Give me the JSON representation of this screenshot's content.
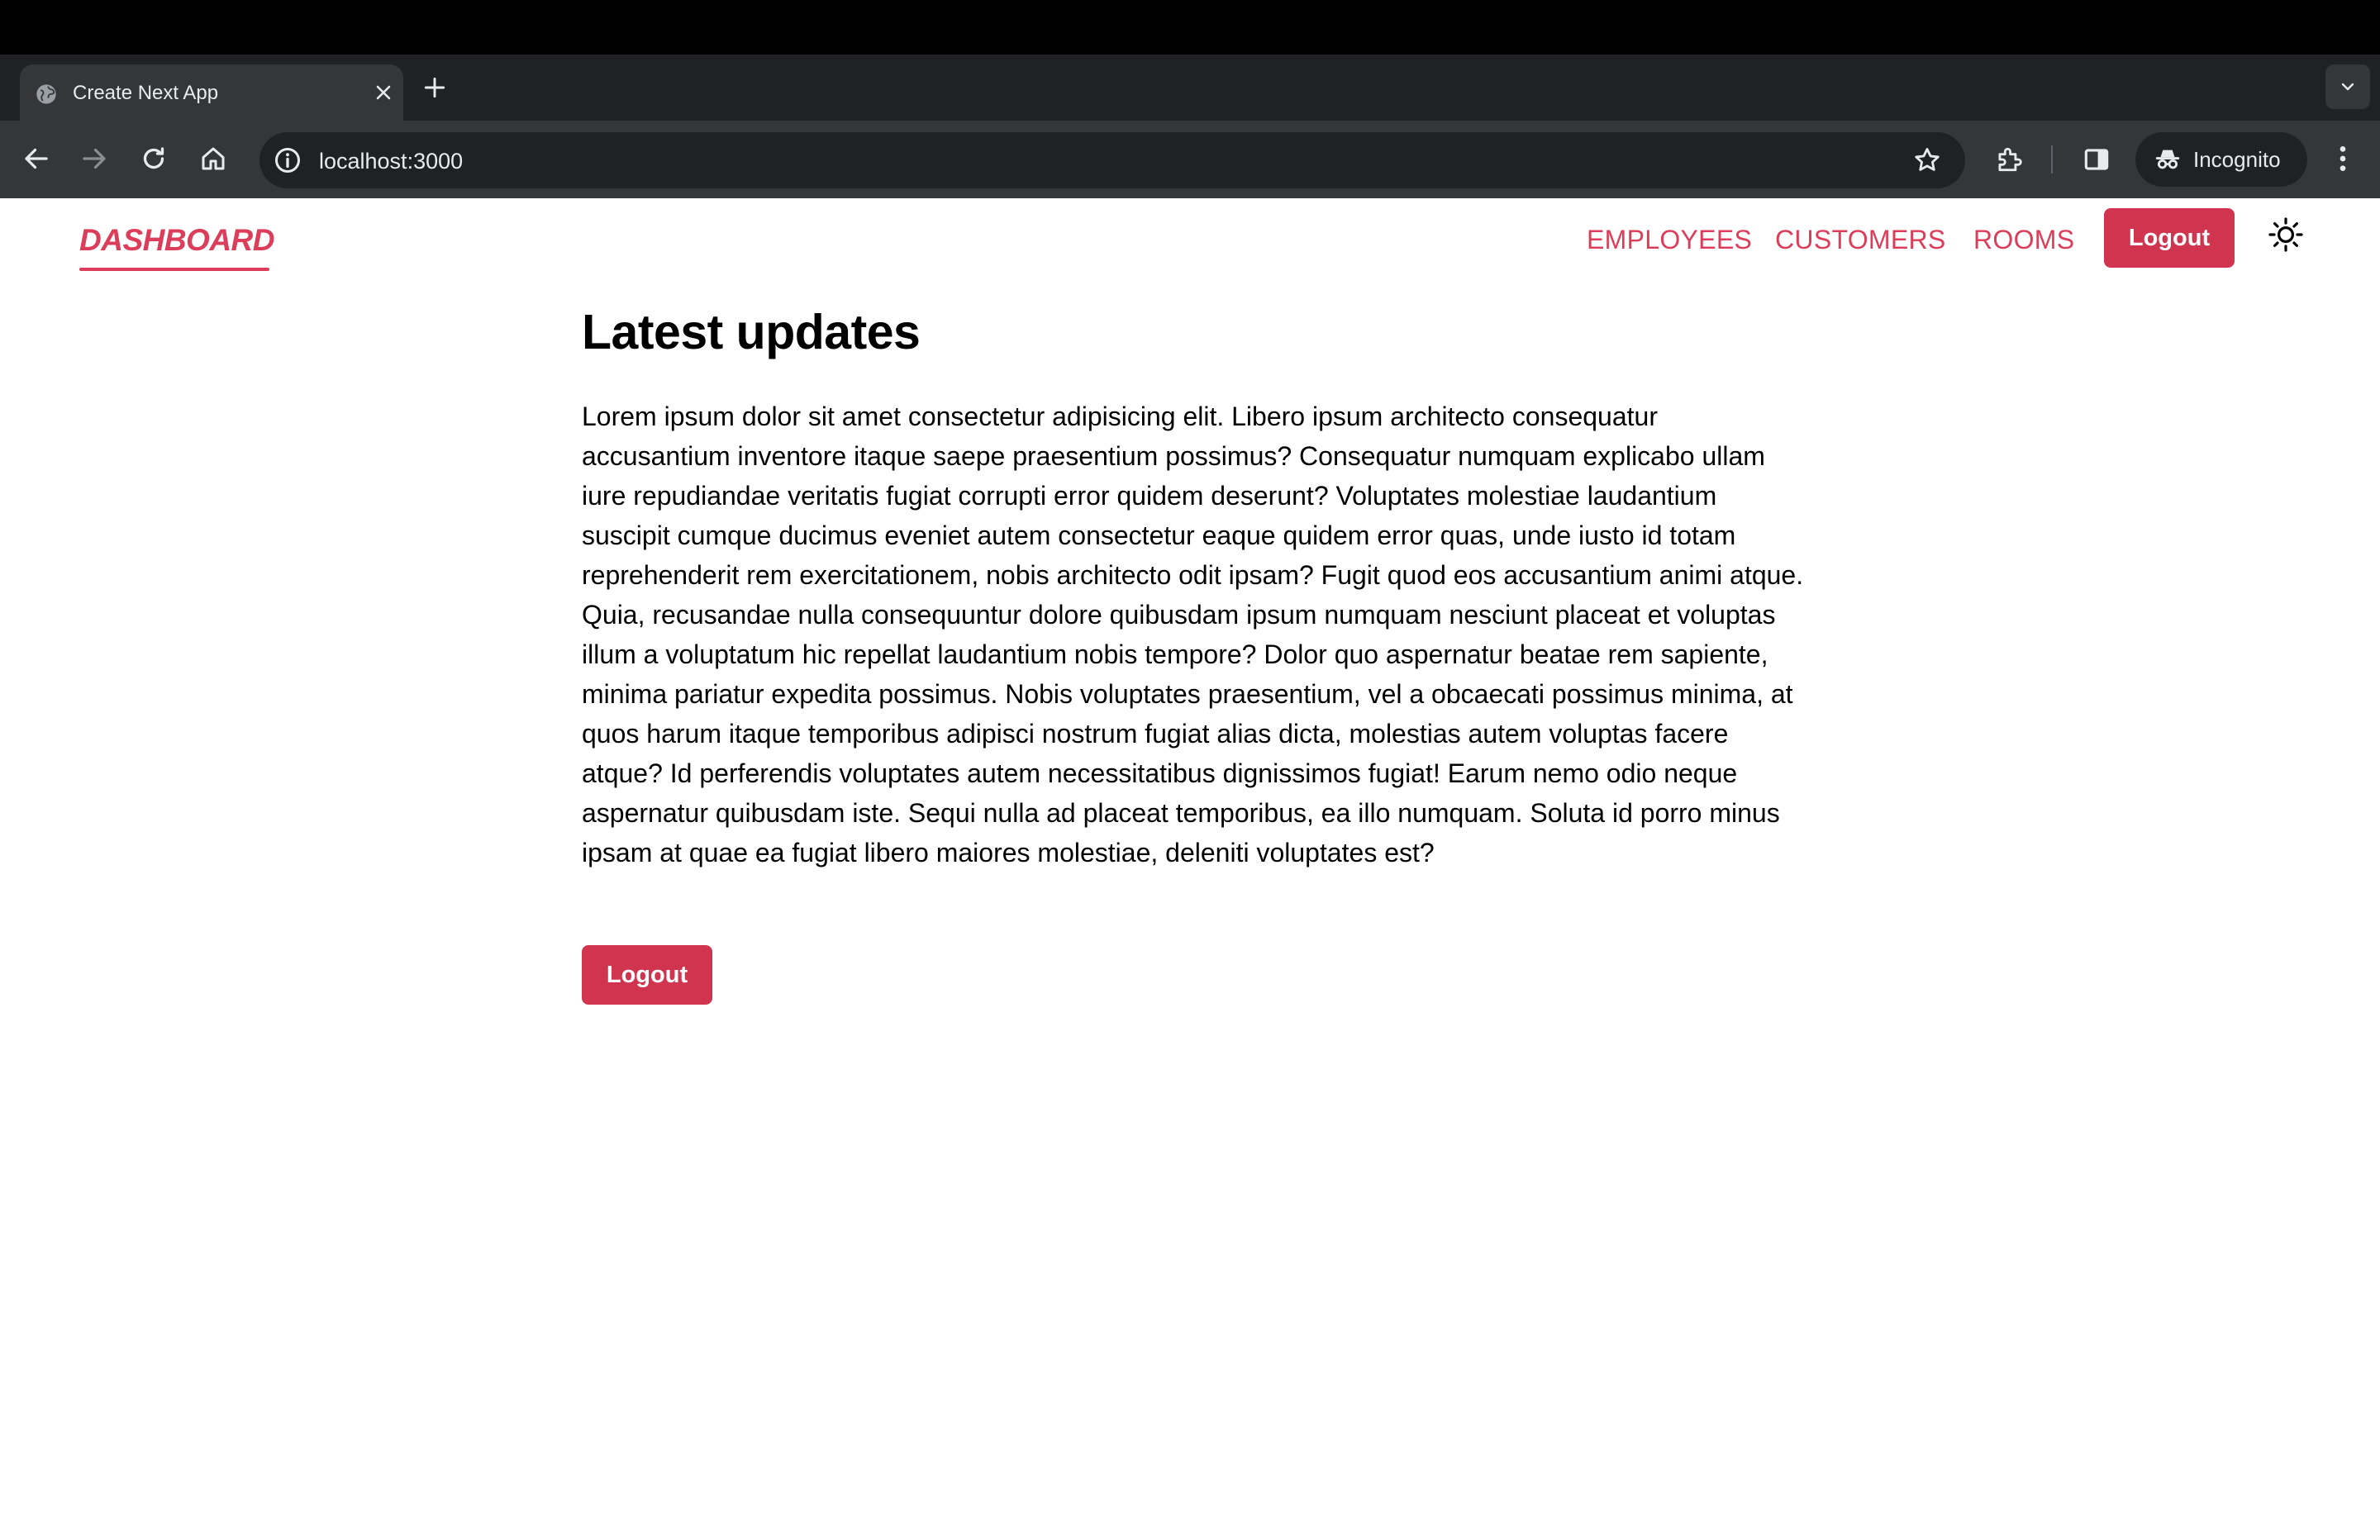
{
  "browser": {
    "tab_title": "Create Next App",
    "url": "localhost:3000",
    "incognito_label": "Incognito"
  },
  "nav": {
    "brand": "DASHBOARD",
    "links": [
      "EMPLOYEES",
      "CUSTOMERS",
      "ROOMS"
    ],
    "logout_label": "Logout"
  },
  "main": {
    "heading": "Latest updates",
    "body": "Lorem ipsum dolor sit amet consectetur adipisicing elit. Libero ipsum architecto consequatur accusantium inventore itaque saepe praesentium possimus? Consequatur numquam explicabo ullam iure repudiandae veritatis fugiat corrupti error quidem deserunt? Voluptates molestiae laudantium suscipit cumque ducimus eveniet autem consectetur eaque quidem error quas, unde iusto id totam reprehenderit rem exercitationem, nobis architecto odit ipsam? Fugit quod eos accusantium animi atque. Quia, recusandae nulla consequuntur dolore quibusdam ipsum numquam nesciunt placeat et voluptas illum a voluptatum hic repellat laudantium nobis tempore? Dolor quo aspernatur beatae rem sapiente, minima pariatur expedita possimus. Nobis voluptates praesentium, vel a obcaecati possimus minima, at quos harum itaque temporibus adipisci nostrum fugiat alias dicta, molestias autem voluptas facere atque? Id perferendis voluptates autem necessitatibus dignissimos fugiat! Earum nemo odio neque aspernatur quibusdam iste. Sequi nulla ad placeat temporibus, ea illo numquam. Soluta id porro minus ipsam at quae ea fugiat libero maiores molestiae, deleniti voluptates est?",
    "logout_label": "Logout"
  },
  "colors": {
    "accent": "#dc3d5a",
    "button": "#d1344f"
  },
  "icons": [
    "globe-favicon-icon",
    "close-icon",
    "plus-icon",
    "chevron-down-icon",
    "back-arrow-icon",
    "forward-arrow-icon",
    "reload-icon",
    "home-icon",
    "site-info-icon",
    "star-icon",
    "extensions-icon",
    "side-panel-icon",
    "incognito-icon",
    "more-vert-icon",
    "sun-icon"
  ]
}
